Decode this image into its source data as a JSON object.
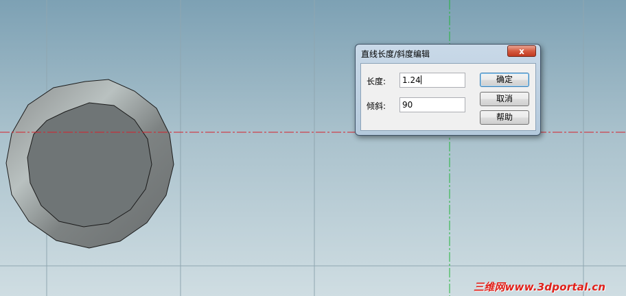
{
  "dialog": {
    "title": "直线长度/斜度编辑",
    "close_label": "x",
    "length_label": "长度:",
    "length_value": "1.24",
    "tilt_label": "倾斜:",
    "tilt_value": "90",
    "ok_label": "确定",
    "cancel_label": "取消",
    "help_label": "帮助"
  },
  "watermark": "三维网www.3dportal.cn",
  "colors": {
    "horizontal_axis": "#d8202a",
    "vertical_axis": "#22b43a",
    "grid": "#8fa6b0"
  }
}
